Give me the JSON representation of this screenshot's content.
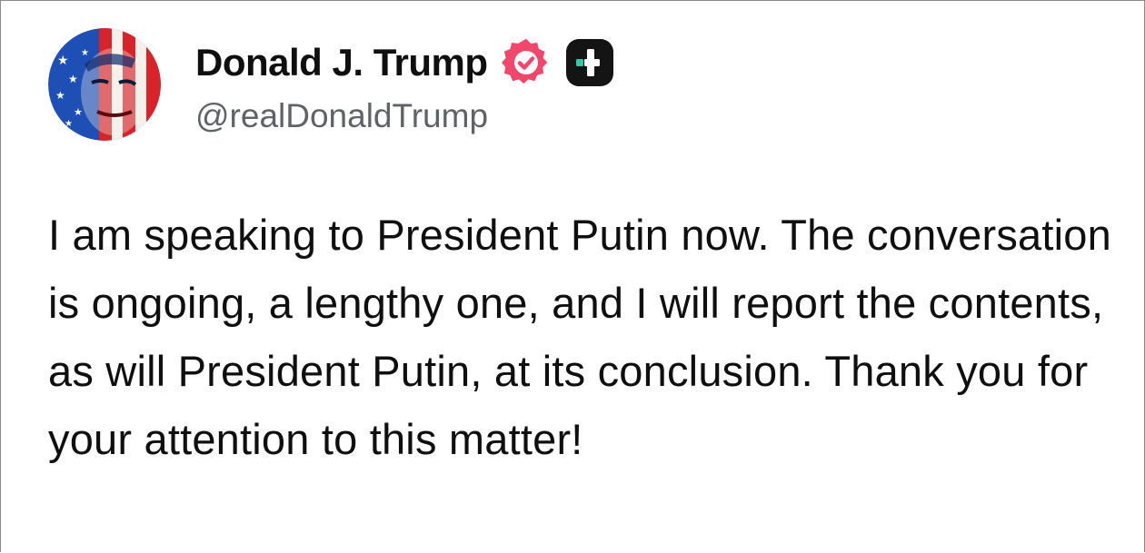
{
  "author": {
    "display_name": "Donald J. Trump",
    "handle": "@realDonaldTrump",
    "verified_icon": "verified-badge-icon",
    "subscription_icon": "plus-badge-icon",
    "avatar": "avatar-image"
  },
  "post": {
    "text": "I am speaking to President Putin now. The conversation is ongoing, a lengthy one, and I will report the contents, as will President Putin, at its conclusion. Thank you for your attention to this matter!"
  },
  "colors": {
    "verified_badge": "#f0476b",
    "plus_badge_bg": "#141414",
    "plus_badge_accent": "#33c9a6",
    "handle_text": "#5f6368",
    "body_text": "#0f0f10"
  }
}
